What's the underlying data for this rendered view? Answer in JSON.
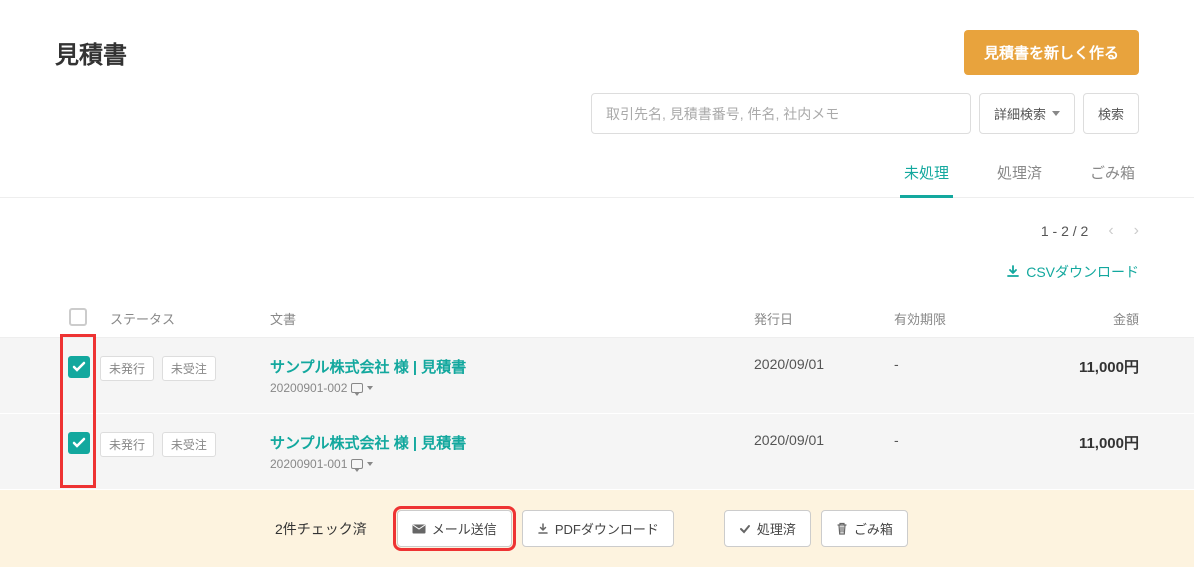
{
  "page": {
    "title": "見積書",
    "createButton": "見積書を新しく作る"
  },
  "search": {
    "placeholder": "取引先名, 見積書番号, 件名, 社内メモ",
    "advancedLabel": "詳細検索",
    "searchLabel": "検索"
  },
  "tabs": {
    "unprocessed": "未処理",
    "processed": "処理済",
    "trash": "ごみ箱"
  },
  "pagination": {
    "range": "1 - 2 / 2"
  },
  "csv": {
    "label": "CSVダウンロード"
  },
  "columns": {
    "status": "ステータス",
    "document": "文書",
    "issueDate": "発行日",
    "expiryDate": "有効期限",
    "amount": "金額"
  },
  "statusPills": {
    "notIssued": "未発行",
    "notOrdered": "未受注"
  },
  "rows": [
    {
      "title": "サンプル株式会社 様 | 見積書",
      "docNo": "20200901-002",
      "issueDate": "2020/09/01",
      "expiryDate": "-",
      "amount": "11,000円"
    },
    {
      "title": "サンプル株式会社 様 | 見積書",
      "docNo": "20200901-001",
      "issueDate": "2020/09/01",
      "expiryDate": "-",
      "amount": "11,000円"
    }
  ],
  "bulkBar": {
    "checkedLabel": "2件チェック済",
    "mailSend": "メール送信",
    "pdfDownload": "PDFダウンロード",
    "markProcessed": "処理済",
    "trash": "ごみ箱"
  }
}
